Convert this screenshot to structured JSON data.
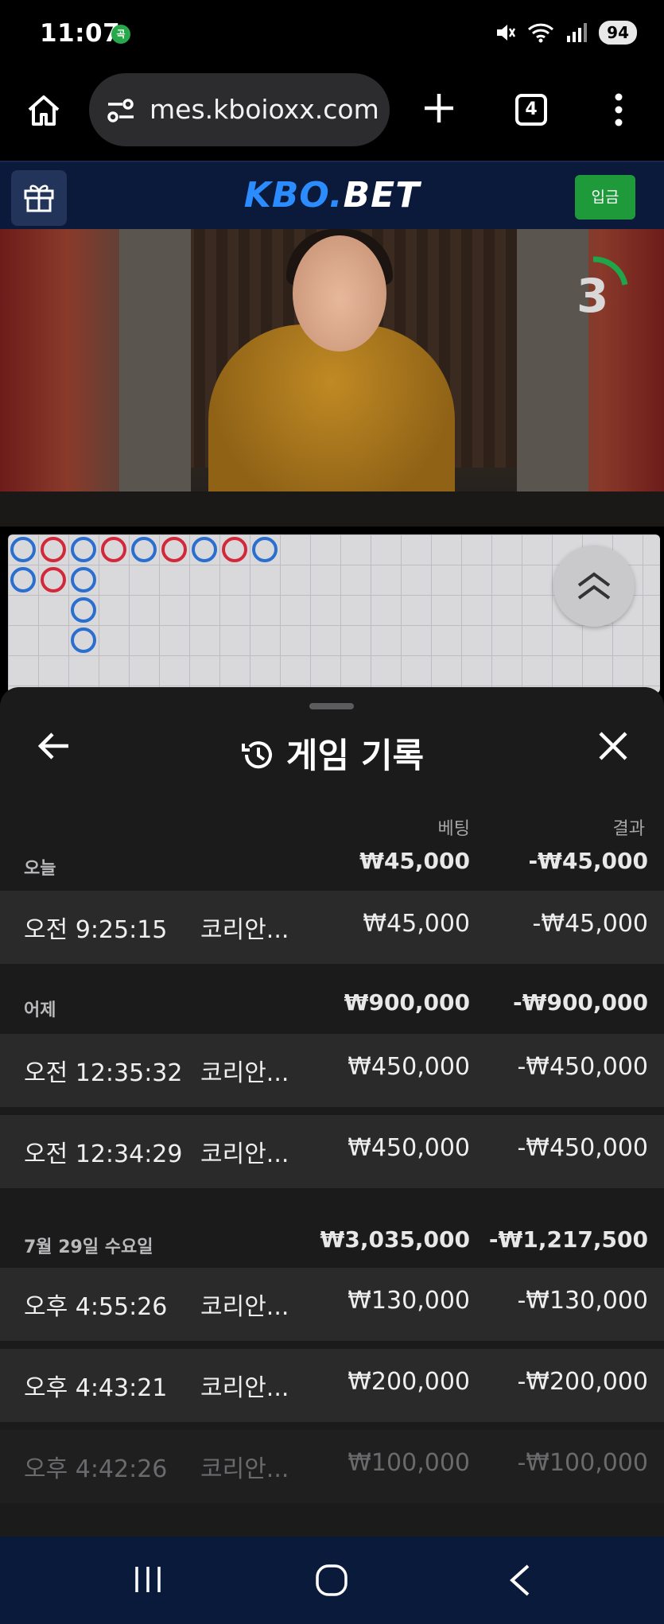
{
  "status_bar": {
    "time": "11:07",
    "notification_badge": "곡",
    "battery": "94",
    "icons": [
      "mute-icon",
      "wifi-icon",
      "signal-icon"
    ]
  },
  "browser": {
    "url": "mes.kboioxx.com",
    "tab_count": "4"
  },
  "site": {
    "logo_part1": "KBO.",
    "logo_part2": "BET",
    "deposit_label": "입금"
  },
  "video": {
    "countdown": "3"
  },
  "roadmap": {
    "columns": [
      [
        "b",
        "b"
      ],
      [
        "r",
        "r"
      ],
      [
        "b",
        "b",
        "b",
        "b"
      ],
      [
        "r"
      ],
      [
        "b"
      ],
      [
        "r"
      ],
      [
        "b"
      ],
      [
        "r"
      ],
      [
        "b"
      ]
    ],
    "colors": {
      "b": "#2a6fcf",
      "r": "#d3283a"
    }
  },
  "sheet": {
    "title": "게임 기록",
    "col_bet": "베팅",
    "col_result": "결과",
    "groups": [
      {
        "label": "오늘",
        "bet_total": "₩45,000",
        "result_total": "-₩45,000",
        "rows": [
          {
            "time": "오전 9:25:15",
            "game": "코리안...",
            "bet": "₩45,000",
            "result": "-₩45,000"
          }
        ]
      },
      {
        "label": "어제",
        "bet_total": "₩900,000",
        "result_total": "-₩900,000",
        "rows": [
          {
            "time": "오전 12:35:32",
            "game": "코리안...",
            "bet": "₩450,000",
            "result": "-₩450,000"
          },
          {
            "time": "오전 12:34:29",
            "game": "코리안...",
            "bet": "₩450,000",
            "result": "-₩450,000"
          }
        ]
      },
      {
        "label": "7월 29일 수요일",
        "bet_total": "₩3,035,000",
        "result_total": "-₩1,217,500",
        "rows": [
          {
            "time": "오후 4:55:26",
            "game": "코리안...",
            "bet": "₩130,000",
            "result": "-₩130,000"
          },
          {
            "time": "오후 4:43:21",
            "game": "코리안...",
            "bet": "₩200,000",
            "result": "-₩200,000"
          },
          {
            "time": "오후 4:42:26",
            "game": "코리안...",
            "bet": "₩100,000",
            "result": "-₩100,000"
          }
        ]
      }
    ]
  }
}
